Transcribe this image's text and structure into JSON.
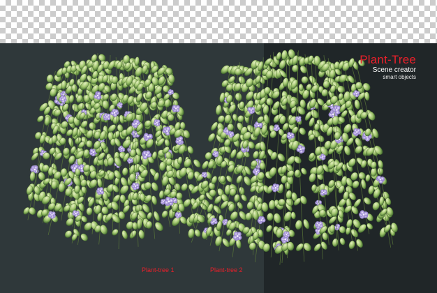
{
  "brand": {
    "title": "Plant-Tree",
    "subtitle": "Scene creator",
    "tagline": "smart objects"
  },
  "labels": {
    "plant1": "Plant-tree 1",
    "plant2": "Plant-tree 2"
  },
  "colors": {
    "label_red": "#e8202a",
    "panel_left": "#2f383a",
    "panel_right": "#202628",
    "leaf_light": "#b9d38a",
    "leaf_dark": "#4f7a34",
    "flower": "#a795d6"
  }
}
